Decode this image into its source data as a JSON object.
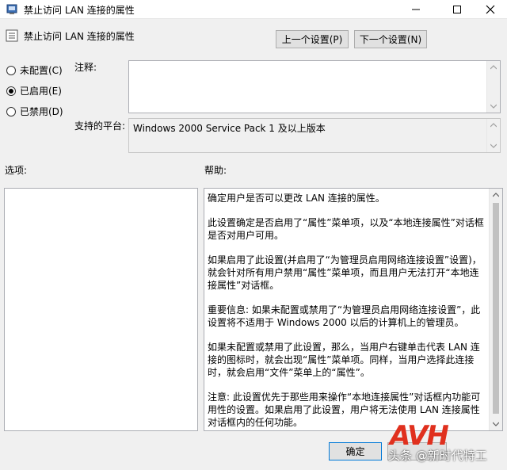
{
  "window": {
    "title": "禁止访问 LAN 连接的属性"
  },
  "header": {
    "policy_name": "禁止访问 LAN 连接的属性",
    "prev_label": "上一个设置(P)",
    "next_label": "下一个设置(N)"
  },
  "state": {
    "options": [
      {
        "label": "未配置(C)",
        "selected": false
      },
      {
        "label": "已启用(E)",
        "selected": true
      },
      {
        "label": "已禁用(D)",
        "selected": false
      }
    ]
  },
  "comment": {
    "label": "注释:",
    "value": ""
  },
  "platform": {
    "label": "支持的平台:",
    "value": "Windows 2000 Service Pack 1 及以上版本"
  },
  "options_section": {
    "label": "选项:"
  },
  "help_section": {
    "label": "帮助:",
    "paragraphs": [
      "确定用户是否可以更改 LAN 连接的属性。",
      "此设置确定是否启用了“属性”菜单项，以及“本地连接属性”对话框是否对用户可用。",
      "如果启用了此设置(并启用了“为管理员启用网络连接设置”设置)，就会针对所有用户禁用“属性”菜单项，而且用户无法打开“本地连接属性”对话框。",
      "重要信息: 如果未配置或禁用了“为管理员启用网络连接设置”，此设置将不适用于 Windows 2000 以后的计算机上的管理员。",
      "如果未配置或禁用了此设置，那么，当用户右键单击代表 LAN 连接的图标时，就会出现“属性”菜单项。同样，当用户选择此连接时，就会启用“文件”菜单上的“属性”。",
      "注意: 此设置优先于那些用来操作“本地连接属性”对话框内功能可用性的设置。如果启用了此设置，用户将无法使用 LAN 连接属性对话框内的任何功能。"
    ]
  },
  "footer": {
    "ok_label": "确定"
  },
  "watermark": {
    "logo": "AVH",
    "text": "头条 @新时代特工"
  }
}
